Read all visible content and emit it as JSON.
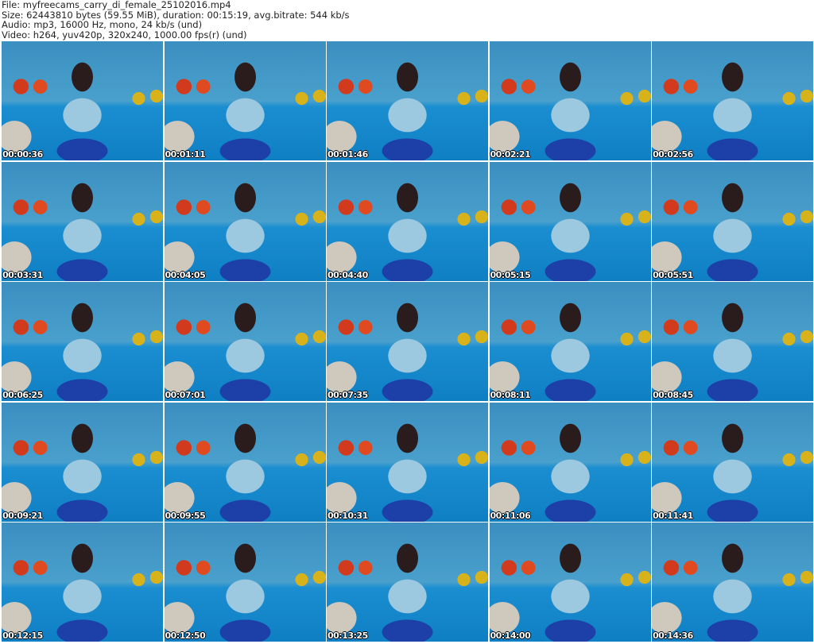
{
  "header": {
    "file": "File: myfreecams_carry_di_female_25102016.mp4",
    "size": "Size: 62443810 bytes (59.55 MiB), duration: 00:15:19, avg.bitrate: 544 kb/s",
    "audio": "Audio: mp3, 16000 Hz, mono, 24 kb/s (und)",
    "video": "Video: h264, yuv420p, 320x240, 1000.00 fps(r) (und)"
  },
  "thumbnails": [
    "00:00:36",
    "00:01:11",
    "00:01:46",
    "00:02:21",
    "00:02:56",
    "00:03:31",
    "00:04:05",
    "00:04:40",
    "00:05:15",
    "00:05:51",
    "00:06:25",
    "00:07:01",
    "00:07:35",
    "00:08:11",
    "00:08:45",
    "00:09:21",
    "00:09:55",
    "00:10:31",
    "00:11:06",
    "00:11:41",
    "00:12:15",
    "00:12:50",
    "00:13:25",
    "00:14:00",
    "00:14:36"
  ]
}
